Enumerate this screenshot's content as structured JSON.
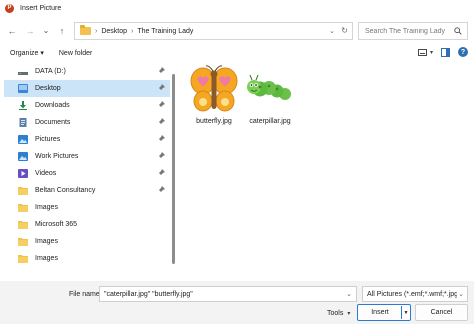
{
  "window": {
    "title": "Insert Picture"
  },
  "nav": {
    "back": "←",
    "forward": "→",
    "recent": "⌄",
    "up": "↑"
  },
  "address": {
    "crumbs": [
      "Desktop",
      "The Training Lady"
    ],
    "separator": "›",
    "dropdown": "⌄",
    "refresh": "↻"
  },
  "search": {
    "placeholder": "Search The Training Lady"
  },
  "toolbar": {
    "organize": "Organize ▾",
    "new_folder": "New folder",
    "help": "?"
  },
  "sidebar": {
    "items": [
      {
        "label": "DATA (D:)",
        "icon": "drive-icon",
        "pinned": true
      },
      {
        "label": "Desktop",
        "icon": "desktop-icon",
        "pinned": true,
        "selected": true
      },
      {
        "label": "Downloads",
        "icon": "downloads-icon",
        "pinned": true
      },
      {
        "label": "Documents",
        "icon": "documents-icon",
        "pinned": true
      },
      {
        "label": "Pictures",
        "icon": "pictures-icon",
        "pinned": true
      },
      {
        "label": "Work Pictures",
        "icon": "pictures-icon",
        "pinned": true
      },
      {
        "label": "Videos",
        "icon": "videos-icon",
        "pinned": true
      },
      {
        "label": "Beltan Consultancy",
        "icon": "folder-icon",
        "pinned": true
      },
      {
        "label": "Images",
        "icon": "folder-icon",
        "pinned": false
      },
      {
        "label": "Microsoft 365",
        "icon": "folder-icon",
        "pinned": false
      },
      {
        "label": "Images",
        "icon": "folder-icon",
        "pinned": false
      },
      {
        "label": "Images",
        "icon": "folder-icon",
        "pinned": false
      }
    ]
  },
  "files": [
    {
      "name": "butterfly.jpg",
      "icon": "butterfly-thumbnail"
    },
    {
      "name": "caterpillar.jpg",
      "icon": "caterpillar-thumbnail"
    }
  ],
  "footer": {
    "file_name_label": "File name:",
    "file_name_value": "\"caterpillar.jpg\" \"butterfly.jpg\"",
    "filter_value": "All Pictures (*.emf;*.wmf;*.jpg;*",
    "tools_label": "Tools",
    "insert_label": "Insert",
    "cancel_label": "Cancel"
  },
  "colors": {
    "accent": "#2a7ad0",
    "selected_bg": "#cce4f7",
    "folder": "#f2c24f"
  }
}
